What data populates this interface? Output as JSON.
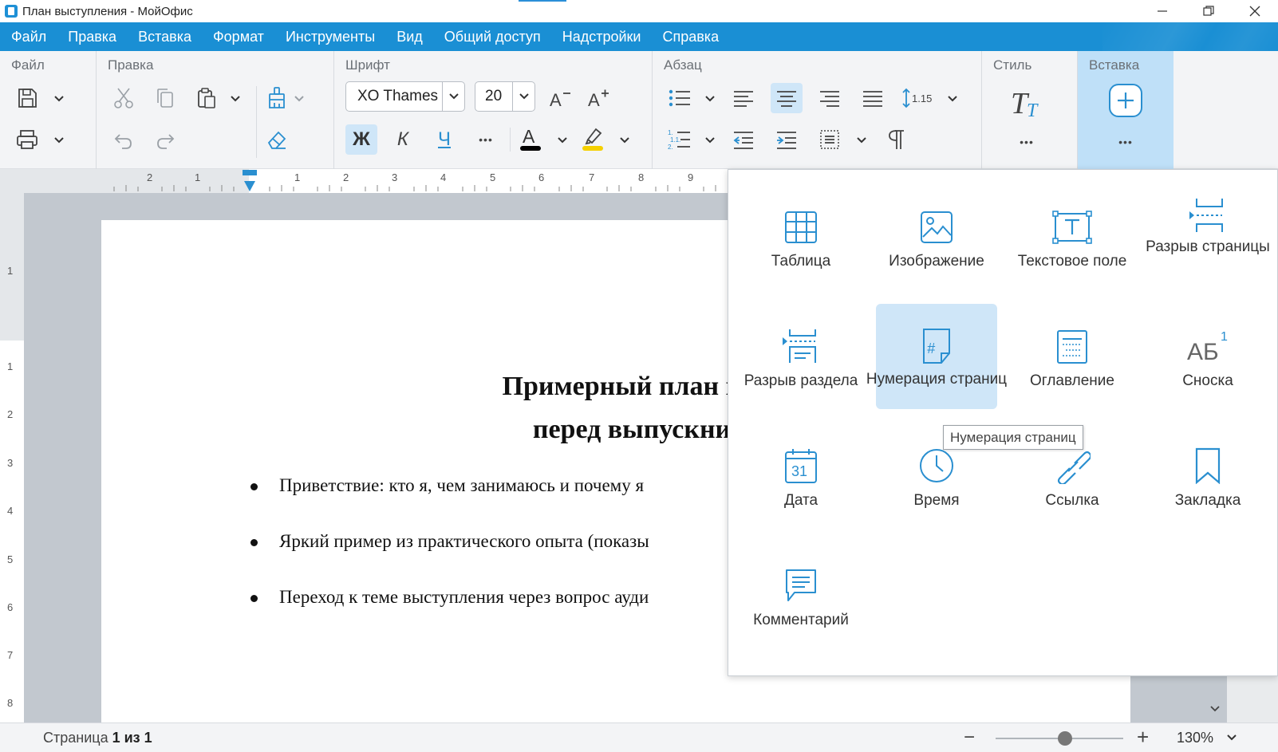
{
  "window": {
    "title": "План выступления - МойОфис"
  },
  "menu": [
    "Файл",
    "Правка",
    "Вставка",
    "Формат",
    "Инструменты",
    "Вид",
    "Общий доступ",
    "Надстройки",
    "Справка"
  ],
  "toolbar": {
    "groups": {
      "file": "Файл",
      "edit": "Правка",
      "font": "Шрифт",
      "paragraph": "Абзац",
      "style": "Стиль",
      "insert": "Вставка"
    },
    "font_name": "XO Thames",
    "font_size": "20",
    "bold_label": "Ж",
    "italic_label": "К",
    "underline_label": "Ч",
    "line_spacing": "1.15",
    "more_label": "•••"
  },
  "ruler": {
    "h_numbers": [
      "2",
      "1",
      "1",
      "2",
      "3",
      "4",
      "5",
      "6",
      "7",
      "8",
      "9"
    ],
    "v_numbers": [
      "1",
      "1",
      "2",
      "3",
      "4",
      "5",
      "6",
      "7",
      "8"
    ]
  },
  "document": {
    "title_line1": "Примерный план вы",
    "title_line2": "перед выпускни",
    "bullets": [
      "Приветствие: кто я, чем занимаюсь и почему я",
      "Яркий пример из практического опыта (показы",
      "Переход к теме выступления через вопрос ауди"
    ]
  },
  "insert_panel": {
    "items": [
      {
        "label": "Таблица",
        "icon": "table-icon"
      },
      {
        "label": "Изображение",
        "icon": "image-icon"
      },
      {
        "label": "Текстовое поле",
        "icon": "text-box-icon"
      },
      {
        "label": "Разрыв страницы",
        "icon": "page-break-icon"
      },
      {
        "label": "Разрыв раздела",
        "icon": "section-break-icon"
      },
      {
        "label": "Нумерация страниц",
        "icon": "page-numbering-icon"
      },
      {
        "label": "Оглавление",
        "icon": "toc-icon"
      },
      {
        "label": "Сноска",
        "icon": "footnote-icon"
      },
      {
        "label": "Дата",
        "icon": "date-icon"
      },
      {
        "label": "Время",
        "icon": "time-icon"
      },
      {
        "label": "Ссылка",
        "icon": "link-icon"
      },
      {
        "label": "Закладка",
        "icon": "bookmark-icon"
      },
      {
        "label": "Комментарий",
        "icon": "comment-icon"
      }
    ],
    "tooltip": "Нумерация страниц",
    "footnote_glyph": "АБ",
    "footnote_sup": "1",
    "date_glyph": "31",
    "page_num_glyph": "#",
    "text_box_glyph": "T"
  },
  "status": {
    "page_prefix": "Страница ",
    "page_current": "1 из 1",
    "zoom": "130%"
  },
  "colors": {
    "accent": "#1a8fd4",
    "icon_blue": "#2a8fd0",
    "hover": "#cfe6f8",
    "insert_active": "#bfe0f8"
  }
}
